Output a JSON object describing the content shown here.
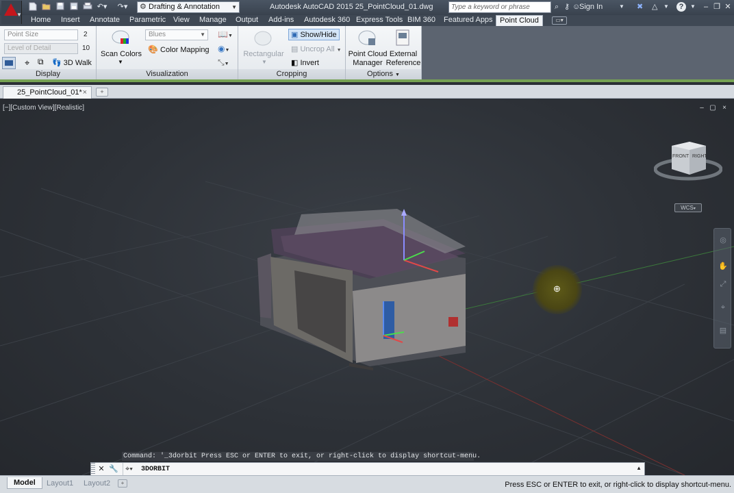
{
  "title_bar": {
    "title": "Autodesk AutoCAD 2015    25_PointCloud_01.dwg",
    "workspace": "Drafting & Annotation",
    "search_placeholder": "Type a keyword or phrase",
    "sign_in": "Sign In",
    "icons": [
      "new-file-icon",
      "open-icon",
      "save-icon",
      "save-as-icon",
      "print-icon",
      "undo-icon",
      "redo-icon",
      "binoculars-icon",
      "key-icon",
      "person-icon",
      "x-exchange-icon",
      "a360-icon",
      "help-icon",
      "minimize-icon",
      "restore-icon",
      "close-icon"
    ]
  },
  "ribbon_tabs": [
    "Home",
    "Insert",
    "Annotate",
    "Parametric",
    "View",
    "Manage",
    "Output",
    "Add-ins",
    "Autodesk 360",
    "Express Tools",
    "BIM 360",
    "Featured Apps",
    "Point Cloud"
  ],
  "active_tab": "Point Cloud",
  "ribbon": {
    "display": {
      "title": "Display",
      "point_size_label": "Point Size",
      "point_size_value": "2",
      "lod_label": "Level of Detail",
      "lod_value": "10",
      "walk_label": "3D Walk"
    },
    "visualization": {
      "title": "Visualization",
      "scan_colors_label": "Scan Colors",
      "color_scheme": "Blues",
      "color_mapping_label": "Color Mapping"
    },
    "cropping": {
      "title": "Cropping",
      "rectangular_label": "Rectangular",
      "show_hide_label": "Show/Hide",
      "uncrop_all_label": "Uncrop All",
      "invert_label": "Invert"
    },
    "options": {
      "title": "Options",
      "manager_label": "Point Cloud Manager",
      "manager_line1": "Point Cloud",
      "manager_line2": "Manager",
      "external_line1": "External",
      "external_line2": "Reference"
    }
  },
  "file_tab": {
    "name": "25_PointCloud_01*",
    "close": "×",
    "new_tab": "+"
  },
  "viewport": {
    "label": "[−][Custom View][Realistic]",
    "controls": [
      "–",
      "▢",
      "×"
    ],
    "viewcube": {
      "front": "FRONT",
      "right": "RIGHT"
    },
    "wcs": "WCS"
  },
  "command": {
    "history": "Command: '_3dorbit Press ESC or ENTER to exit, or right-click to display shortcut-menu.",
    "current": "3DORBIT"
  },
  "layout_tabs": [
    "Model",
    "Layout1",
    "Layout2"
  ],
  "active_layout": "Model",
  "status_message": "Press ESC or ENTER to exit, or right-click to display shortcut-menu.",
  "colors": {
    "accent_green": "#76a253",
    "autocad_red": "#c4161c",
    "viewport_bg": "#2d3137"
  }
}
